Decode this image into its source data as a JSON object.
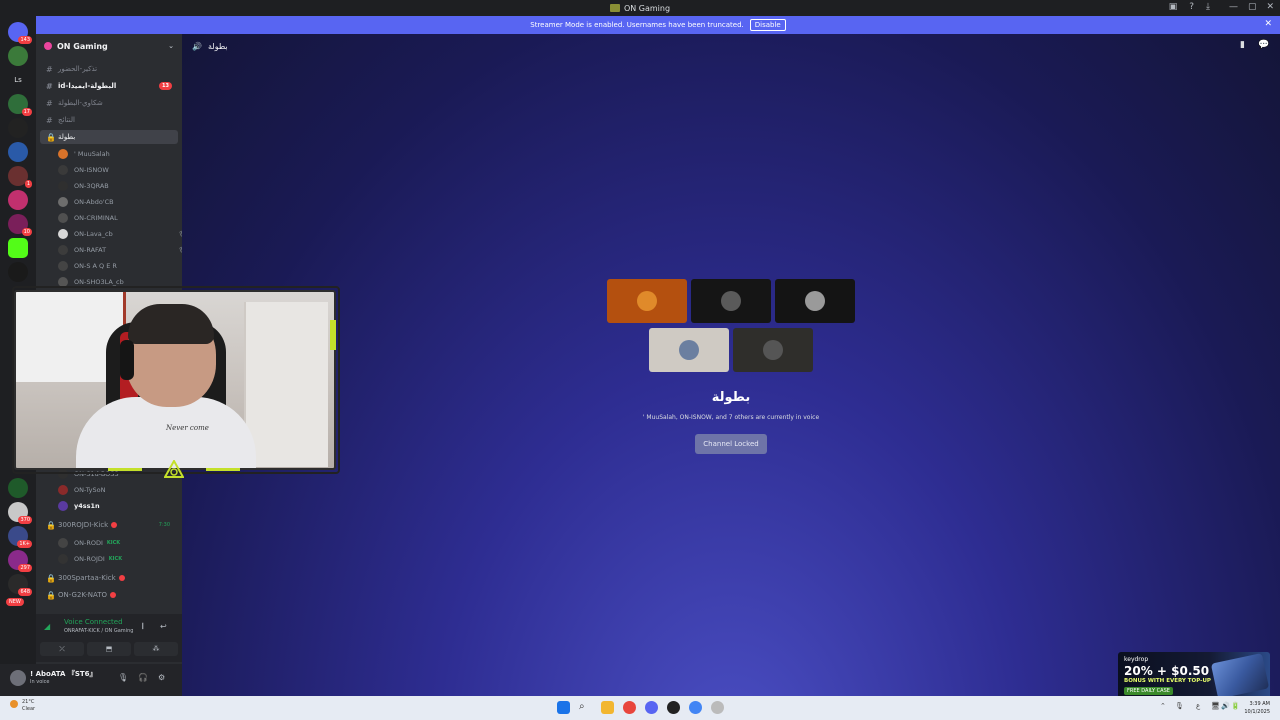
{
  "window": {
    "title": "ON Gaming",
    "title_icons": [
      "▣",
      "?",
      "⤓"
    ],
    "controls": [
      "—",
      "▢",
      "✕"
    ]
  },
  "banner": {
    "text": "Streamer Mode is enabled. Usernames have been truncated.",
    "button": "Disable",
    "close": "✕"
  },
  "guilds": {
    "badges": [
      "143",
      "17",
      "1",
      "10",
      "370",
      "1K+",
      "297",
      "648"
    ],
    "top_label": "Ls",
    "new_label": "NEW"
  },
  "server": {
    "name": "ON Gaming",
    "chevron": "⌄"
  },
  "channels": [
    {
      "name": "تذكير-الحضور",
      "type": "text"
    },
    {
      "name": "id-البطولة-ايميدا",
      "type": "text",
      "mentions": "13"
    },
    {
      "name": "شكاوي-البطولة",
      "type": "text"
    },
    {
      "name": "النتائج",
      "type": "text"
    },
    {
      "name": "بطولة",
      "type": "voice-locked"
    }
  ],
  "voice_members": [
    {
      "name": "' MuuSalah",
      "color": "#d9732a"
    },
    {
      "name": "ON-ISNOW",
      "color": "#3a3a3a"
    },
    {
      "name": "ON-3QRAB",
      "color": "#2f2f2f"
    },
    {
      "name": "ON-Abdo'CB",
      "color": "#6d6d6d"
    },
    {
      "name": "ON-CRIMINAL",
      "color": "#505050"
    },
    {
      "name": "ON-Lava_cb",
      "color": "#d8d8d8",
      "muted": true
    },
    {
      "name": "ON-RAFAT",
      "color": "#3c3c3c",
      "muted": true
    },
    {
      "name": "ON-S A Q E R",
      "color": "#444"
    },
    {
      "name": "ON-SHO3LA_cb",
      "color": "#555"
    }
  ],
  "voice_members_lower": [
    {
      "name": "ON-S1d-BOSS",
      "color": "#2f2f2f"
    },
    {
      "name": "ON-TySoN",
      "color": "#8a2a2a"
    },
    {
      "name": "y4ss1n",
      "color": "#5a3aa0"
    }
  ],
  "other_channels": [
    {
      "name": "300ROJDI-Kick",
      "timer": "7:30",
      "live": true
    },
    {
      "name": "300Spartaa-Kick",
      "live": true
    },
    {
      "name": "ON-G2K-NATO",
      "live": true
    }
  ],
  "rojdi_members": [
    {
      "name": "ON-RODI",
      "tag": "KICK",
      "color": "#444"
    },
    {
      "name": "ON-ROJDI",
      "tag": "KICK",
      "color": "#333"
    }
  ],
  "voice_panel": {
    "title": "Voice Connected",
    "subtitle": "ONRAFAT-KICK / ON Gaming",
    "icons": [
      "𝄃",
      "↩"
    ],
    "buttons": [
      "⤫",
      "⬒",
      "⁂"
    ]
  },
  "user": {
    "name": "! AboATA 『ST6』",
    "status": "In voice",
    "controls": [
      "🎙",
      "🎧",
      "⚙"
    ]
  },
  "main": {
    "channel_name": "بطولة",
    "header_icons": [
      "▮",
      "💬"
    ],
    "title": "بطولة",
    "description": "' MuuSalah, ON-ISNOW, and 7 others are currently in voice",
    "button": "Channel Locked"
  },
  "tiles": [
    {
      "bg": "#b4500f",
      "avatar": "#e08a2a"
    },
    {
      "bg": "#151515",
      "avatar": "#5a5a5a"
    },
    {
      "bg": "#141414",
      "avatar": "#9a9a9a"
    },
    {
      "bg": "#cfcac3",
      "avatar": "#6b7fa0"
    },
    {
      "bg": "#2f2e2b",
      "avatar": "#555"
    }
  ],
  "webcam": {
    "shirt_text": "Never come"
  },
  "ad": {
    "logo": "keydrop",
    "headline": "20% + $0.50",
    "sub": "BONUS WITH EVERY TOP-UP",
    "cta": "FREE DAILY CASE"
  },
  "taskbar": {
    "temp": "21°C",
    "weather": "Clear",
    "time": "3:39 AM",
    "date": "10/1/2025",
    "tray": [
      "⌃",
      "🎙",
      "ع",
      "🖥",
      "🔊",
      "🔋"
    ]
  },
  "colors": {
    "accent": "#5865f2",
    "online": "#23a55a",
    "alert": "#f23f43"
  }
}
